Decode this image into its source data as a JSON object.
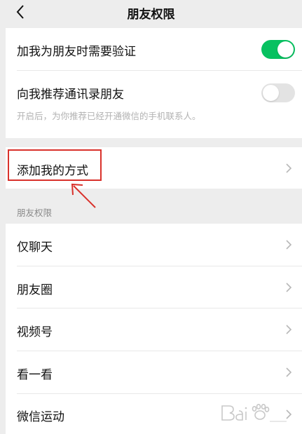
{
  "navbar": {
    "title": "朋友权限"
  },
  "settings": {
    "verify_label": "加我为朋友时需要验证",
    "verify_on": true,
    "recommend_label": "向我推荐通讯录朋友",
    "recommend_on": false,
    "recommend_desc": "开启后，为你推荐已经开通微信的手机联系人。",
    "add_me_label": "添加我的方式"
  },
  "friend_permissions": {
    "header": "朋友权限",
    "items": [
      {
        "label": "仅聊天"
      },
      {
        "label": "朋友圈"
      },
      {
        "label": "视频号"
      },
      {
        "label": "看一看"
      },
      {
        "label": "微信运动"
      }
    ]
  },
  "colors": {
    "toggle_on": "#07c160",
    "toggle_off": "#e3e3e3",
    "annotation": "#d9312b"
  },
  "watermark": {
    "icon": "baidu-paw-logo"
  }
}
